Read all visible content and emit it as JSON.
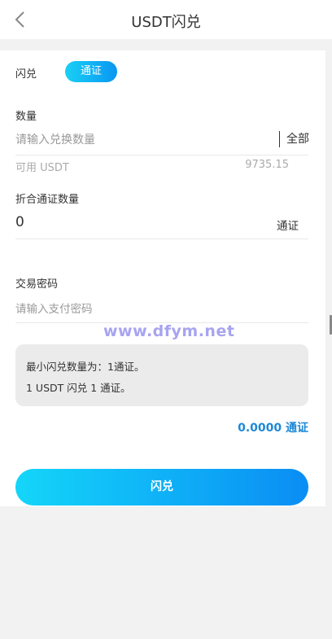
{
  "header": {
    "title": "USDT闪兑"
  },
  "swap": {
    "label": "闪兑",
    "token": "通证"
  },
  "amount": {
    "label": "数量",
    "placeholder": "请输入兑换数量",
    "all_label": "全部",
    "available_label": "可用 USDT",
    "available_value": "9735.15"
  },
  "converted": {
    "label": "折合通证数量",
    "value": "0",
    "unit": "通证"
  },
  "password": {
    "label": "交易密码",
    "placeholder": "请输入支付密码"
  },
  "notice": {
    "line1": "最小闪兑数量为：1通证。",
    "line2": "1 USDT 闪兑 1 通证。"
  },
  "total": {
    "text": "0.0000 通证"
  },
  "submit": {
    "label": "闪兑"
  },
  "watermark": {
    "text": "www.dfym.net"
  },
  "colors": {
    "accent_start": "#14d6f9",
    "accent_end": "#0a8df4",
    "total_text": "#1e88d6"
  },
  "icons": {
    "back": "chevron-left-icon"
  }
}
